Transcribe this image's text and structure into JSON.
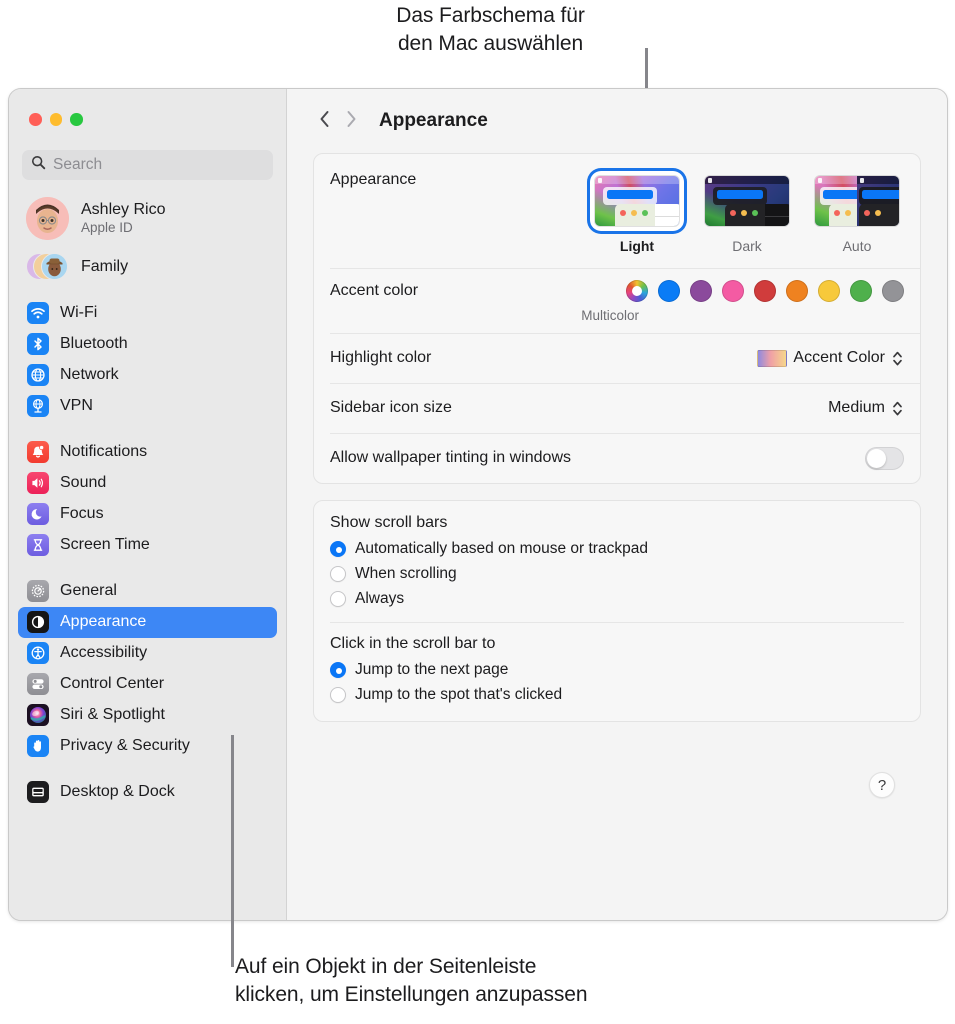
{
  "callouts": {
    "top": "Das Farbschema für\nden Mac auswählen",
    "bottom": "Auf ein Objekt in der Seitenleiste\nklicken, um Einstellungen anzupassen"
  },
  "window": {
    "traffic_lights": [
      "close",
      "minimize",
      "zoom"
    ]
  },
  "sidebar": {
    "search": {
      "placeholder": "Search",
      "value": "",
      "icon": "search-icon"
    },
    "account": {
      "name": "Ashley Rico",
      "subtitle": "Apple ID",
      "avatar": "memoji-avatar"
    },
    "family": {
      "label": "Family",
      "icon": "family-avatars"
    },
    "groups": [
      {
        "items": [
          {
            "label": "Wi-Fi",
            "icon": "wifi-icon",
            "selected": false
          },
          {
            "label": "Bluetooth",
            "icon": "bluetooth-icon",
            "selected": false
          },
          {
            "label": "Network",
            "icon": "network-globe-icon",
            "selected": false
          },
          {
            "label": "VPN",
            "icon": "vpn-icon",
            "selected": false
          }
        ]
      },
      {
        "items": [
          {
            "label": "Notifications",
            "icon": "bell-icon",
            "selected": false
          },
          {
            "label": "Sound",
            "icon": "speaker-icon",
            "selected": false
          },
          {
            "label": "Focus",
            "icon": "moon-icon",
            "selected": false
          },
          {
            "label": "Screen Time",
            "icon": "hourglass-icon",
            "selected": false
          }
        ]
      },
      {
        "items": [
          {
            "label": "General",
            "icon": "gear-icon",
            "selected": false
          },
          {
            "label": "Appearance",
            "icon": "appearance-icon",
            "selected": true
          },
          {
            "label": "Accessibility",
            "icon": "accessibility-icon",
            "selected": false
          },
          {
            "label": "Control Center",
            "icon": "control-center-icon",
            "selected": false
          },
          {
            "label": "Siri & Spotlight",
            "icon": "siri-icon",
            "selected": false
          },
          {
            "label": "Privacy & Security",
            "icon": "hand-icon",
            "selected": false
          }
        ]
      },
      {
        "items": [
          {
            "label": "Desktop & Dock",
            "icon": "desktop-dock-icon",
            "selected": false
          }
        ]
      }
    ]
  },
  "toolbar": {
    "back_icon": "chevron-left-icon",
    "forward_icon": "chevron-right-icon",
    "title": "Appearance"
  },
  "main": {
    "appearance": {
      "label": "Appearance",
      "options": [
        {
          "name": "Light",
          "selected": true
        },
        {
          "name": "Dark",
          "selected": false
        },
        {
          "name": "Auto",
          "selected": false
        }
      ]
    },
    "accent_color": {
      "label": "Accent color",
      "caption": "Multicolor",
      "swatches": [
        {
          "name": "Multicolor",
          "color": "multicolor",
          "selected": true
        },
        {
          "name": "Blue",
          "color": "#0a7cf6",
          "selected": false
        },
        {
          "name": "Purple",
          "color": "#8b4a9c",
          "selected": false
        },
        {
          "name": "Pink",
          "color": "#f45ba3",
          "selected": false
        },
        {
          "name": "Red",
          "color": "#d03c3c",
          "selected": false
        },
        {
          "name": "Orange",
          "color": "#ef8220",
          "selected": false
        },
        {
          "name": "Yellow",
          "color": "#f7c93b",
          "selected": false
        },
        {
          "name": "Green",
          "color": "#4fb04c",
          "selected": false
        },
        {
          "name": "Graphite",
          "color": "#939397",
          "selected": false
        }
      ]
    },
    "highlight_color": {
      "label": "Highlight color",
      "value": "Accent Color"
    },
    "sidebar_icon_size": {
      "label": "Sidebar icon size",
      "value": "Medium"
    },
    "wallpaper_tinting": {
      "label": "Allow wallpaper tinting in windows",
      "on": false
    },
    "show_scroll_bars": {
      "title": "Show scroll bars",
      "options": [
        {
          "label": "Automatically based on mouse or trackpad",
          "selected": true
        },
        {
          "label": "When scrolling",
          "selected": false
        },
        {
          "label": "Always",
          "selected": false
        }
      ]
    },
    "click_scroll_bar": {
      "title": "Click in the scroll bar to",
      "options": [
        {
          "label": "Jump to the next page",
          "selected": true
        },
        {
          "label": "Jump to the spot that's clicked",
          "selected": false
        }
      ]
    },
    "help_button": {
      "label": "?",
      "icon": "help-icon"
    }
  }
}
